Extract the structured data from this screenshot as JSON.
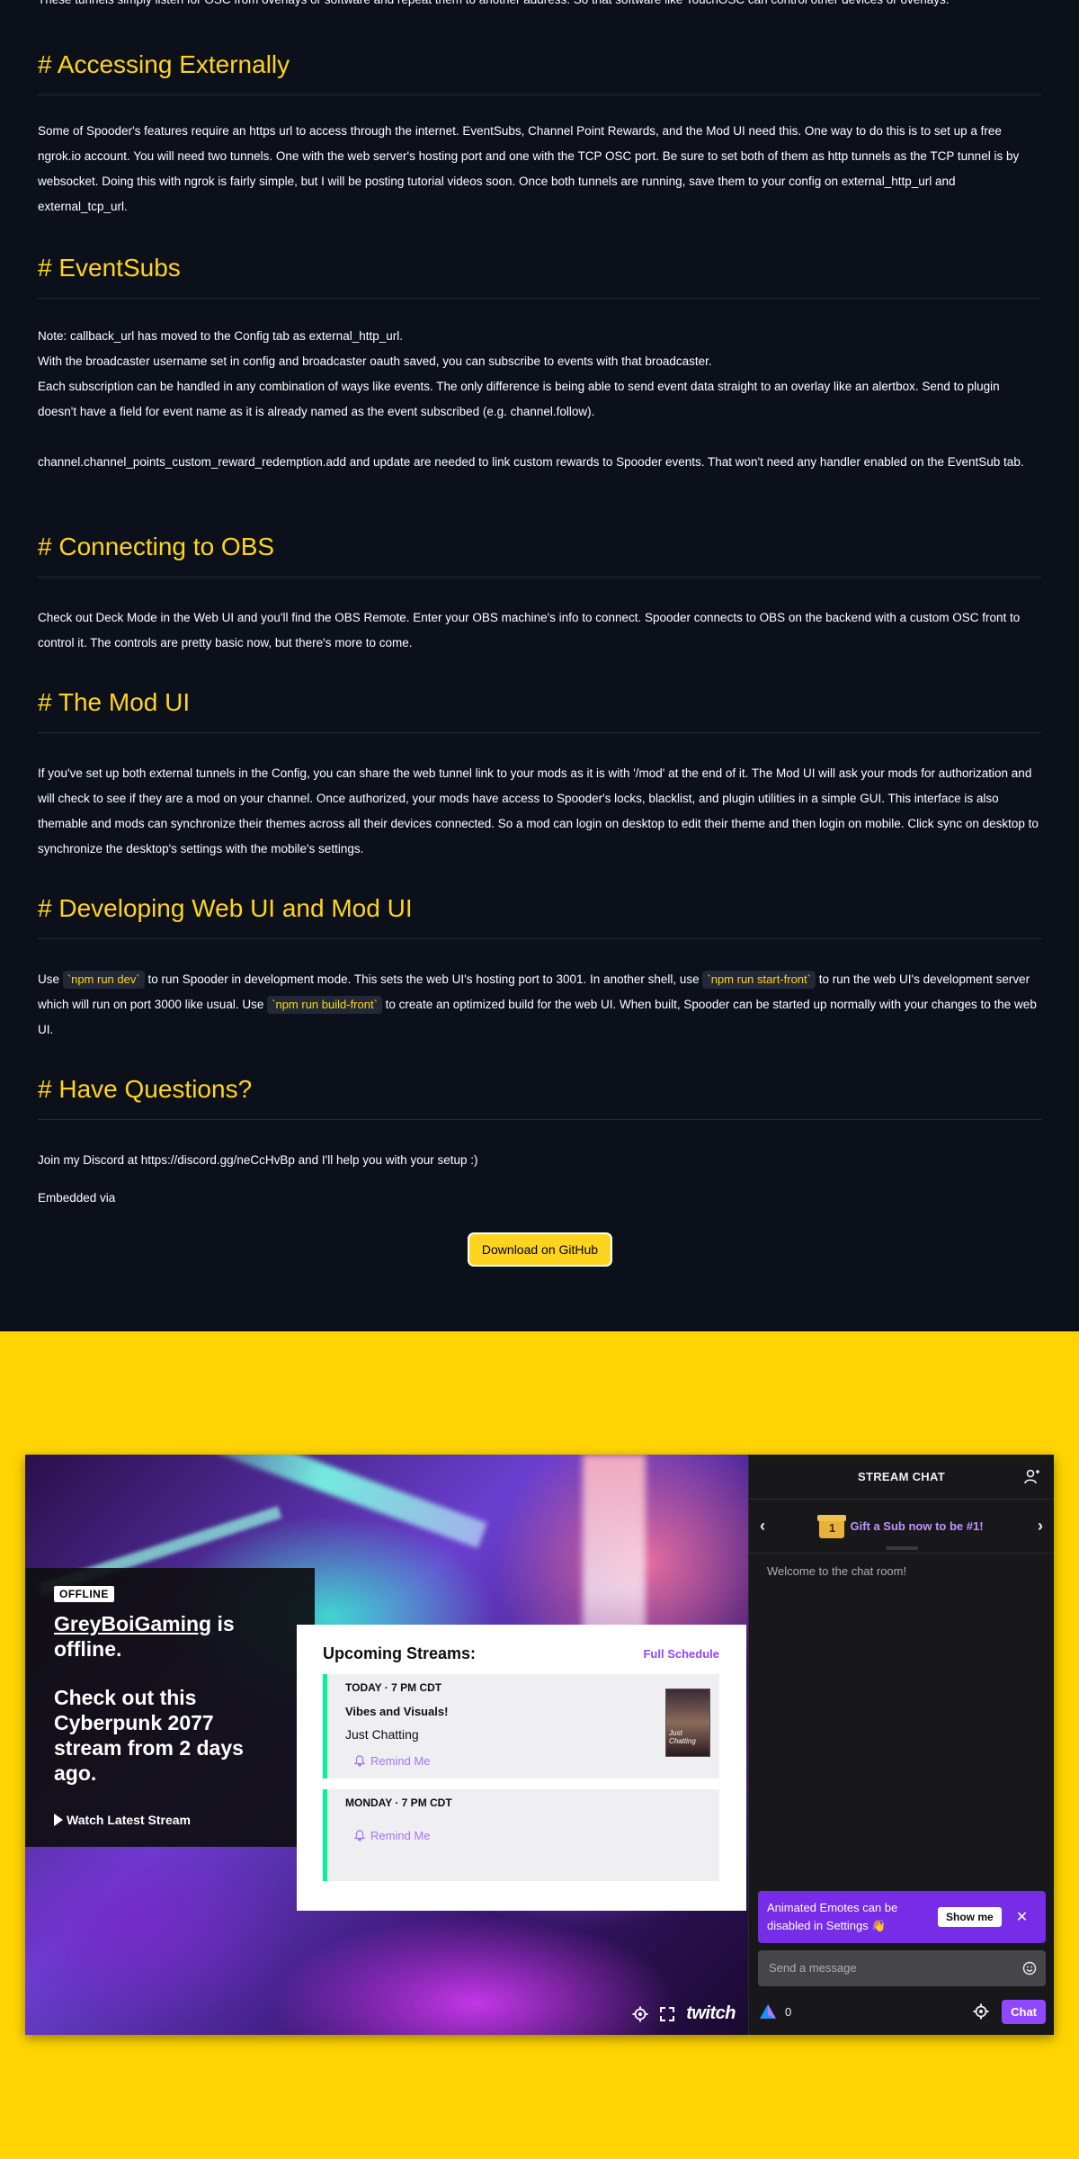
{
  "doc": {
    "intro_tail": "These tunnels simply listen for OSC from overlays or software and repeat them to another address. So that software like TouchOSC can control other devices or overlays.",
    "sections": [
      {
        "heading": "# Accessing Externally",
        "paragraphs": [
          "Some of Spooder's features require an https url to access through the internet. EventSubs, Channel Point Rewards, and the Mod UI need this. One way to do this is to set up a free ngrok.io account. You will need two tunnels. One with the web server's hosting port and one with the TCP OSC port. Be sure to set both of them as http tunnels as the TCP tunnel is by websocket. Doing this with ngrok is fairly simple, but I will be posting tutorial videos soon. Once both tunnels are running, save them to your config on external_http_url and external_tcp_url."
        ]
      },
      {
        "heading": "# EventSubs",
        "paragraphs": [
          "Note: callback_url has moved to the Config tab as external_http_url.",
          "With the broadcaster username set in config and broadcaster oauth saved, you can subscribe to events with that broadcaster.",
          "Each subscription can be handled in any combination of ways like events. The only difference is being able to send event data straight to an overlay like an alertbox. Send to plugin doesn't have a field for event name as it is already named as the event subscribed (e.g. channel.follow).",
          "channel.channel_points_custom_reward_redemption.add and update are needed to link custom rewards to Spooder events. That won't need any handler enabled on the EventSub tab."
        ]
      },
      {
        "heading": "# Connecting to OBS",
        "paragraphs": [
          "Check out Deck Mode in the Web UI and you'll find the OBS Remote. Enter your OBS machine's info to connect. Spooder connects to OBS on the backend with a custom OSC front to control it. The controls are pretty basic now, but there's more to come."
        ]
      },
      {
        "heading": "# The Mod UI",
        "paragraphs": [
          "If you've set up both external tunnels in the Config, you can share the web tunnel link to your mods as it is with '/mod' at the end of it. The Mod UI will ask your mods for authorization and will check to see if they are a mod on your channel. Once authorized, your mods have access to Spooder's locks, blacklist, and plugin utilities in a simple GUI. This interface is also themable and mods can synchronize their themes across all their devices connected. So a mod can login on desktop to edit their theme and then login on mobile. Click sync on desktop to synchronize the desktop's settings with the mobile's settings."
        ]
      },
      {
        "heading": "# Developing Web UI and Mod UI",
        "dev": {
          "t1": "Use ",
          "c1": "`npm run dev`",
          "t2": " to run Spooder in development mode. This sets the web UI's hosting port to 3001. In another shell, use ",
          "c2": "`npm run start-front`",
          "t3": " to run the web UI's development server which will run on port 3000 like usual. Use ",
          "c3": "`npm run build-front`",
          "t4": " to create an optimized build for the web UI. When built, Spooder can be started up normally with your changes to the web UI."
        }
      },
      {
        "heading": "# Have Questions?",
        "paragraphs": [
          "Join my Discord at https://discord.gg/neCcHvBp and I'll help you with your setup :)",
          "Embedded via"
        ]
      }
    ],
    "github_button": "Download on GitHub"
  },
  "embed": {
    "offline_badge": "OFFLINE",
    "channel_name": "GreyBoiGaming",
    "is_offline": " is offline.",
    "check_out": "Check out this Cyberpunk 2077 stream from 2 days ago.",
    "watch_latest": "Watch Latest Stream",
    "schedule": {
      "title": "Upcoming Streams:",
      "full_schedule": "Full Schedule",
      "items": [
        {
          "time": "TODAY · 7 PM CDT",
          "title": "Vibes and Visuals!",
          "category": "Just Chatting",
          "remind": "Remind Me",
          "boxart_text": "Just Chatting"
        },
        {
          "time": "MONDAY · 7 PM CDT",
          "remind": "Remind Me"
        }
      ]
    },
    "twitch_logo": "twitch",
    "chat": {
      "header": "STREAM CHAT",
      "gift_count": "1",
      "gift_text": "Gift a Sub now to be #1!",
      "welcome": "Welcome to the chat room!",
      "emote_banner": "Animated Emotes can be disabled in Settings",
      "show_me": "Show me",
      "close": "✕",
      "placeholder": "Send a message",
      "points": "0",
      "chat_button": "Chat"
    }
  },
  "colors": {
    "doc_bg": "#0c101b",
    "heading_yellow": "#ffd41e",
    "page_yellow": "#ffd400",
    "twitch_purple": "#9147ff",
    "schedule_accent": "#00f593"
  }
}
